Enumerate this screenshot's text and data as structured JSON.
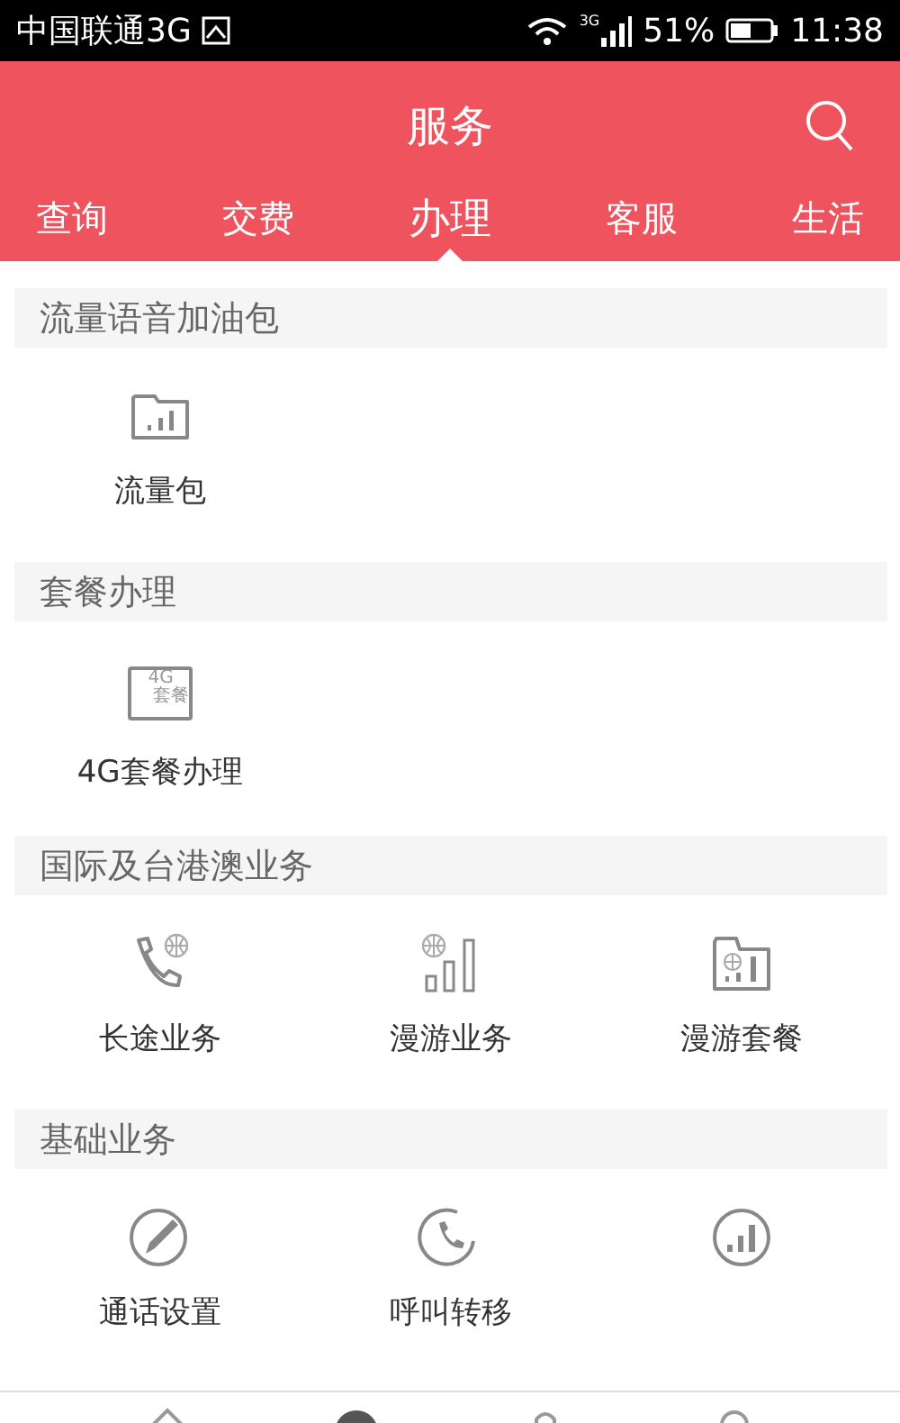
{
  "status_bar": {
    "carrier": "中国联通3G",
    "network": "3G",
    "battery": "51%",
    "time": "11:38"
  },
  "header": {
    "title": "服务"
  },
  "tabs": [
    {
      "label": "查询",
      "selected": false
    },
    {
      "label": "交费",
      "selected": false
    },
    {
      "label": "办理",
      "selected": true
    },
    {
      "label": "客服",
      "selected": false
    },
    {
      "label": "生活",
      "selected": false
    }
  ],
  "sections": [
    {
      "title": "流量语音加油包",
      "items": [
        {
          "kind": "folder-bars",
          "label": "流量包"
        }
      ]
    },
    {
      "title": "套餐办理",
      "items": [
        {
          "kind": "plan-card",
          "badge": "4G",
          "badge_sub": "套餐",
          "label": "4G套餐办理"
        }
      ]
    },
    {
      "title": "国际及台港澳业务",
      "items": [
        {
          "kind": "phone-globe",
          "label": "长途业务"
        },
        {
          "kind": "signal-globe",
          "label": "漫游业务"
        },
        {
          "kind": "folder-globe",
          "label": "漫游套餐"
        }
      ]
    },
    {
      "title": "基础业务",
      "items": [
        {
          "kind": "pencil-circle",
          "label": "通话设置"
        },
        {
          "kind": "phone-circle",
          "label": "呼叫转移"
        },
        {
          "kind": "signal-circle"
        }
      ]
    }
  ],
  "bottom_nav": [
    {
      "kind": "home",
      "selected": false
    },
    {
      "kind": "face",
      "selected": true
    },
    {
      "kind": "bag",
      "selected": false
    },
    {
      "kind": "person",
      "selected": false
    }
  ]
}
